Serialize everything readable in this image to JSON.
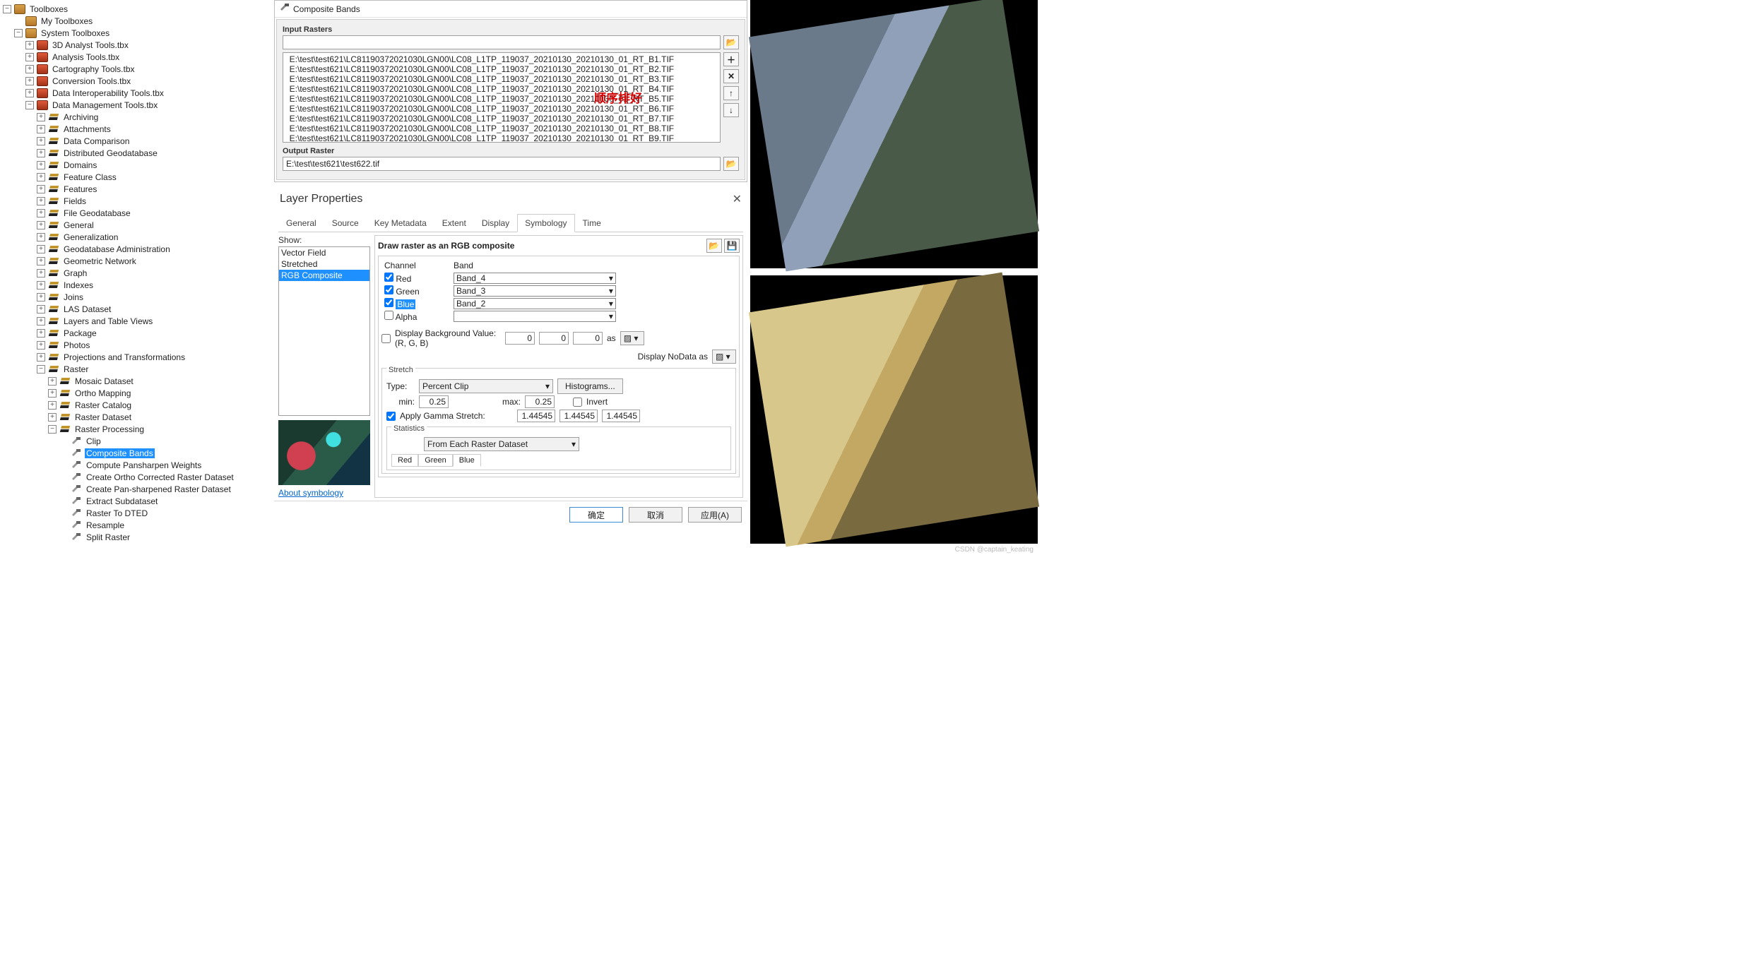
{
  "tree": {
    "root": "Toolboxes",
    "my": "My Toolboxes",
    "sys": "System Toolboxes",
    "sys_items": [
      "3D Analyst Tools.tbx",
      "Analysis Tools.tbx",
      "Cartography Tools.tbx",
      "Conversion Tools.tbx",
      "Data Interoperability Tools.tbx"
    ],
    "dm": "Data Management Tools.tbx",
    "dm_sets": [
      "Archiving",
      "Attachments",
      "Data Comparison",
      "Distributed Geodatabase",
      "Domains",
      "Feature Class",
      "Features",
      "Fields",
      "File Geodatabase",
      "General",
      "Generalization",
      "Geodatabase Administration",
      "Geometric Network",
      "Graph",
      "Indexes",
      "Joins",
      "LAS Dataset",
      "Layers and Table Views",
      "Package",
      "Photos",
      "Projections and Transformations"
    ],
    "raster": "Raster",
    "raster_sets": [
      "Mosaic Dataset",
      "Ortho Mapping",
      "Raster Catalog",
      "Raster Dataset"
    ],
    "rp": "Raster Processing",
    "rp_tools": [
      "Clip",
      "Composite Bands",
      "Compute Pansharpen Weights",
      "Create Ortho Corrected Raster Dataset",
      "Create Pan-sharpened Raster Dataset",
      "Extract Subdataset",
      "Raster To DTED",
      "Resample",
      "Split Raster"
    ],
    "selected_tool": "Composite Bands"
  },
  "cb": {
    "title": "Composite Bands",
    "input_lbl": "Input Rasters",
    "rasters": [
      "E:\\test\\test621\\LC81190372021030LGN00\\LC08_L1TP_119037_20210130_20210130_01_RT_B1.TIF",
      "E:\\test\\test621\\LC81190372021030LGN00\\LC08_L1TP_119037_20210130_20210130_01_RT_B2.TIF",
      "E:\\test\\test621\\LC81190372021030LGN00\\LC08_L1TP_119037_20210130_20210130_01_RT_B3.TIF",
      "E:\\test\\test621\\LC81190372021030LGN00\\LC08_L1TP_119037_20210130_20210130_01_RT_B4.TIF",
      "E:\\test\\test621\\LC81190372021030LGN00\\LC08_L1TP_119037_20210130_20210130_01_RT_B5.TIF",
      "E:\\test\\test621\\LC81190372021030LGN00\\LC08_L1TP_119037_20210130_20210130_01_RT_B6.TIF",
      "E:\\test\\test621\\LC81190372021030LGN00\\LC08_L1TP_119037_20210130_20210130_01_RT_B7.TIF",
      "E:\\test\\test621\\LC81190372021030LGN00\\LC08_L1TP_119037_20210130_20210130_01_RT_B8.TIF",
      "E:\\test\\test621\\LC81190372021030LGN00\\LC08_L1TP_119037_20210130_20210130_01_RT_B9.TIF"
    ],
    "annotation": "顺序排好",
    "output_lbl": "Output Raster",
    "output_val": "E:\\test\\test621\\test622.tif"
  },
  "lp": {
    "title": "Layer Properties",
    "tabs": [
      "General",
      "Source",
      "Key Metadata",
      "Extent",
      "Display",
      "Symbology",
      "Time"
    ],
    "active_tab": "Symbology",
    "show_lbl": "Show:",
    "show_opts": [
      "Vector Field",
      "Stretched",
      "RGB Composite"
    ],
    "show_sel": "RGB Composite",
    "about": "About symbology",
    "panel_title": "Draw raster as an RGB composite",
    "ch_hdr": {
      "c": "Channel",
      "b": "Band"
    },
    "channels": [
      {
        "on": true,
        "name": "Red",
        "band": "Band_4"
      },
      {
        "on": true,
        "name": "Green",
        "band": "Band_3"
      },
      {
        "on": true,
        "name": "Blue",
        "band": "Band_2",
        "hl": true
      },
      {
        "on": false,
        "name": "Alpha",
        "band": ""
      }
    ],
    "bgval_lbl": "Display Background Value:(R, G, B)",
    "bg_r": "0",
    "bg_g": "0",
    "bg_b": "0",
    "as": "as",
    "nodata_lbl": "Display NoData as",
    "stretch_lbl": "Stretch",
    "type_lbl": "Type:",
    "type_val": "Percent Clip",
    "hist": "Histograms...",
    "min_lbl": "min:",
    "min_val": "0.25",
    "max_lbl": "max:",
    "max_val": "0.25",
    "invert": "Invert",
    "gamma_lbl": "Apply Gamma Stretch:",
    "g1": "1.44545",
    "g2": "1.44545",
    "g3": "1.44545",
    "stats_lbl": "Statistics",
    "stats_val": "From Each Raster Dataset",
    "stat_tabs": [
      "Red",
      "Green",
      "Blue"
    ],
    "ok": "确定",
    "cancel": "取消",
    "apply": "应用(A)"
  },
  "watermark": "CSDN @captain_keating"
}
